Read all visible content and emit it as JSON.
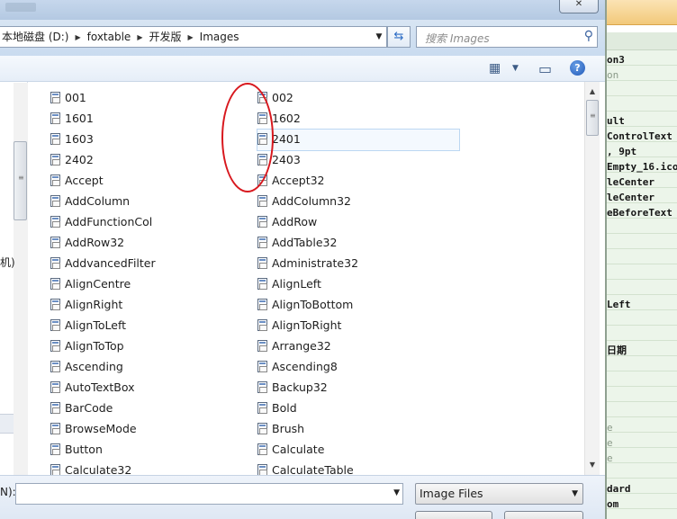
{
  "address": {
    "crumbs": [
      "本地磁盘 (D:)",
      "foxtable",
      "开发版",
      "Images"
    ],
    "sep_glyph": "▶",
    "dropdown_glyph": "▼",
    "refresh_glyph": "⇆"
  },
  "search": {
    "placeholder": "搜索 Images",
    "icon": "search-icon"
  },
  "toolbar": {
    "views_glyph": "▦",
    "views_dd": "▼",
    "preview_glyph": "▭",
    "help_glyph": "?"
  },
  "window": {
    "close_glyph": "✕"
  },
  "nav": {
    "fragment": "机)"
  },
  "files": {
    "column1": [
      "001",
      "1601",
      "1603",
      "2402",
      "Accept",
      "AddColumn",
      "AddFunctionCol",
      "AddRow32",
      "AddvancedFilter",
      "AlignCentre",
      "AlignRight",
      "AlignToLeft",
      "AlignToTop",
      "Ascending",
      "AutoTextBox",
      "BarCode",
      "BrowseMode",
      "Button",
      "Calculate32"
    ],
    "column2": [
      "002",
      "1602",
      "2401",
      "2403",
      "Accept32",
      "AddColumn32",
      "AddRow",
      "AddTable32",
      "Administrate32",
      "AlignLeft",
      "AlignToBottom",
      "AlignToRight",
      "Arrange32",
      "Ascending8",
      "Backup32",
      "Bold",
      "Brush",
      "Calculate",
      "CalculateTable"
    ],
    "selected": "2401"
  },
  "scroll": {
    "up": "▲",
    "down": "▼",
    "left_arrow": "◀",
    "grip": "≡"
  },
  "bottom": {
    "filename_label": "N):",
    "filename_value": "",
    "filetype_value": "Image Files",
    "dropdown_glyph": "▼"
  },
  "propgrid": {
    "rows": [
      {
        "text": "on3",
        "dim": false
      },
      {
        "text": "on",
        "dim": true
      },
      {
        "text": "ult",
        "dim": false
      },
      {
        "text": "ControlText",
        "dim": false
      },
      {
        "text": ", 9pt",
        "dim": false
      },
      {
        "text": "Empty_16.ico",
        "dim": false
      },
      {
        "text": "leCenter",
        "dim": false
      },
      {
        "text": "leCenter",
        "dim": false
      },
      {
        "text": "eBeforeText",
        "dim": false
      },
      {
        "text": " Left",
        "dim": false
      },
      {
        "text": "日期",
        "dim": false
      },
      {
        "text": "e",
        "dim": true
      },
      {
        "text": "e",
        "dim": true
      },
      {
        "text": "e",
        "dim": true
      },
      {
        "text": "dard",
        "dim": false
      },
      {
        "text": "om",
        "dim": false
      }
    ]
  }
}
